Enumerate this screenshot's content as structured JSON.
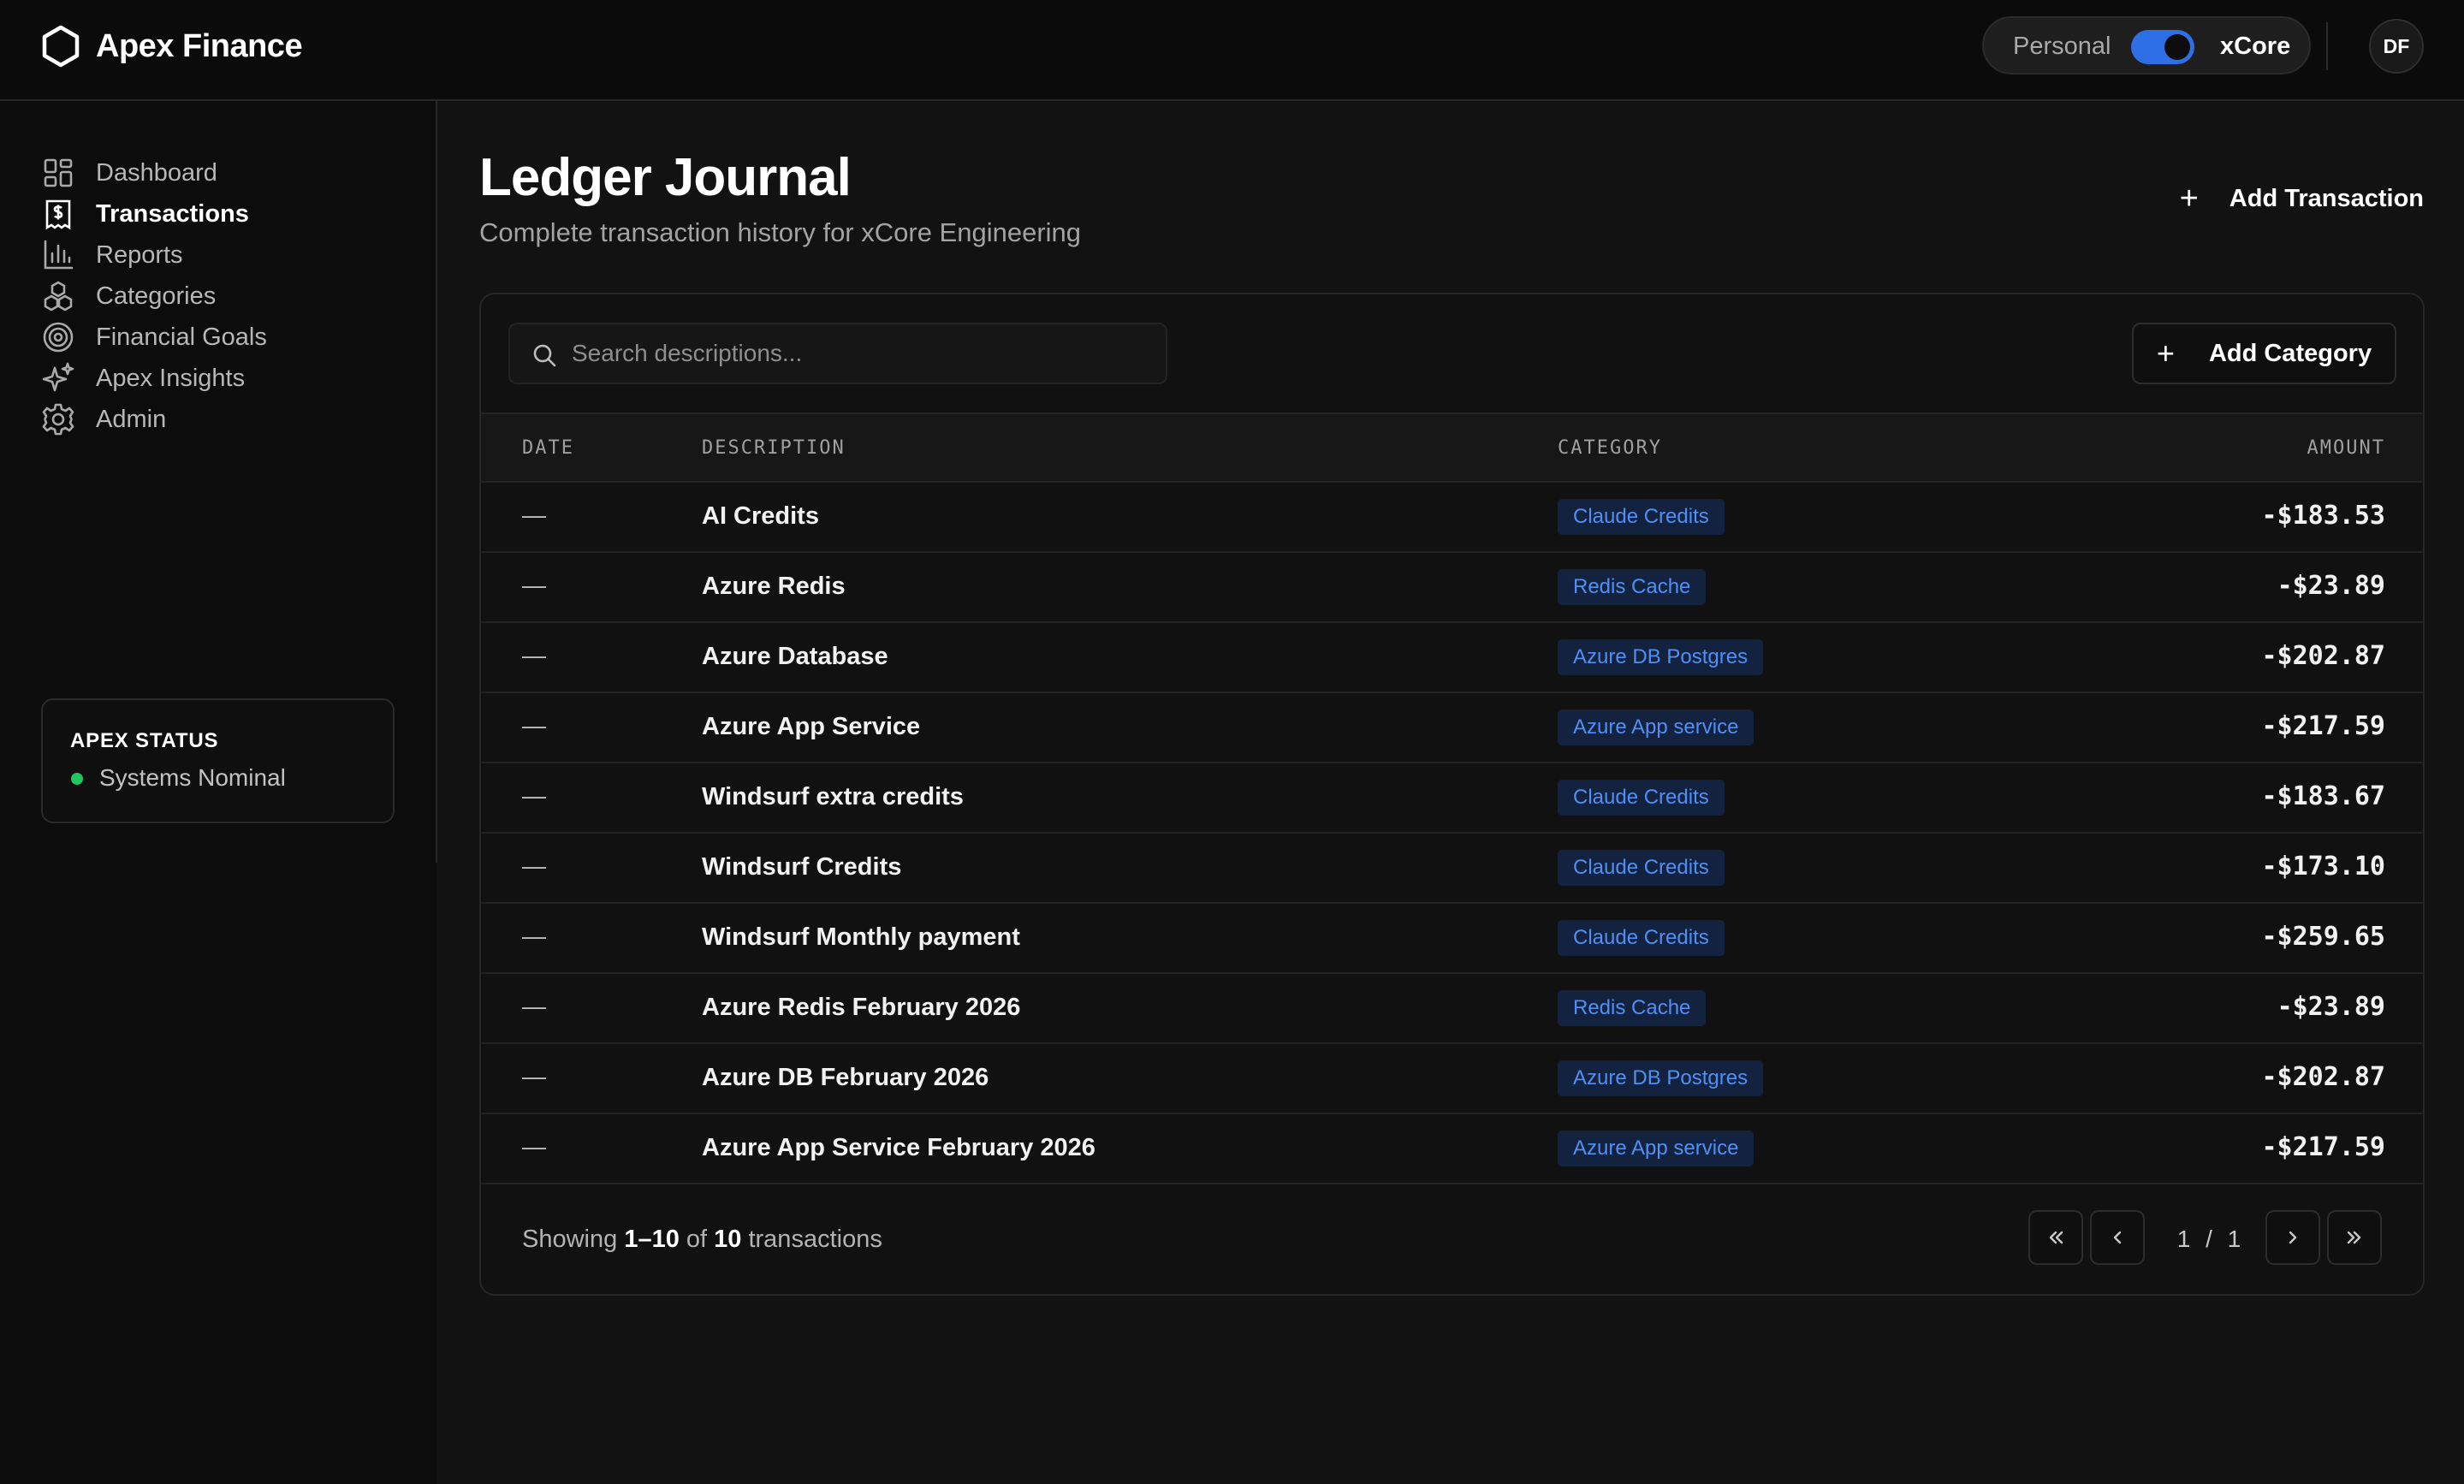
{
  "app": {
    "name": "Apex Finance"
  },
  "workspace": {
    "personal_label": "Personal",
    "active_label": "xCore",
    "toggle_on": true
  },
  "user": {
    "initials": "DF"
  },
  "sidebar": {
    "items": [
      {
        "label": "Dashboard",
        "icon": "dashboard-grid-icon",
        "active": false
      },
      {
        "label": "Transactions",
        "icon": "receipt-dollar-icon",
        "active": true
      },
      {
        "label": "Reports",
        "icon": "bar-chart-icon",
        "active": false
      },
      {
        "label": "Categories",
        "icon": "shapes-icon",
        "active": false
      },
      {
        "label": "Financial Goals",
        "icon": "target-icon",
        "active": false
      },
      {
        "label": "Apex Insights",
        "icon": "sparkles-icon",
        "active": false
      },
      {
        "label": "Admin",
        "icon": "gear-icon",
        "active": false
      }
    ],
    "status": {
      "title": "APEX STATUS",
      "text": "Systems Nominal",
      "color": "#22c55e"
    }
  },
  "page": {
    "title": "Ledger Journal",
    "subtitle": "Complete transaction history for xCore Engineering",
    "add_transaction_label": "Add Transaction"
  },
  "toolbar": {
    "search_placeholder": "Search descriptions...",
    "add_category_label": "Add Category"
  },
  "table": {
    "headers": {
      "date": "DATE",
      "description": "DESCRIPTION",
      "category": "CATEGORY",
      "amount": "AMOUNT"
    },
    "rows": [
      {
        "date": "—",
        "description": "AI Credits",
        "category": "Claude Credits",
        "amount": "-$183.53"
      },
      {
        "date": "—",
        "description": "Azure Redis",
        "category": "Redis Cache",
        "amount": "-$23.89"
      },
      {
        "date": "—",
        "description": "Azure Database",
        "category": "Azure DB Postgres",
        "amount": "-$202.87"
      },
      {
        "date": "—",
        "description": "Azure App Service",
        "category": "Azure App service",
        "amount": "-$217.59"
      },
      {
        "date": "—",
        "description": "Windsurf extra credits",
        "category": "Claude Credits",
        "amount": "-$183.67"
      },
      {
        "date": "—",
        "description": "Windsurf Credits",
        "category": "Claude Credits",
        "amount": "-$173.10"
      },
      {
        "date": "—",
        "description": "Windsurf Monthly payment",
        "category": "Claude Credits",
        "amount": "-$259.65"
      },
      {
        "date": "—",
        "description": "Azure Redis February 2026",
        "category": "Redis Cache",
        "amount": "-$23.89"
      },
      {
        "date": "—",
        "description": "Azure DB February 2026",
        "category": "Azure DB Postgres",
        "amount": "-$202.87"
      },
      {
        "date": "—",
        "description": "Azure App Service February 2026",
        "category": "Azure App service",
        "amount": "-$217.59"
      }
    ]
  },
  "pagination": {
    "showing_prefix": "Showing",
    "range": "1–10",
    "of": "of",
    "total": "10",
    "suffix": "transactions",
    "current_page": "1",
    "separator": "/",
    "total_pages": "1"
  },
  "colors": {
    "accent": "#2f6fe6",
    "category_text": "#4f8ff6",
    "category_bg": "#13233f",
    "status_ok": "#22c55e"
  }
}
